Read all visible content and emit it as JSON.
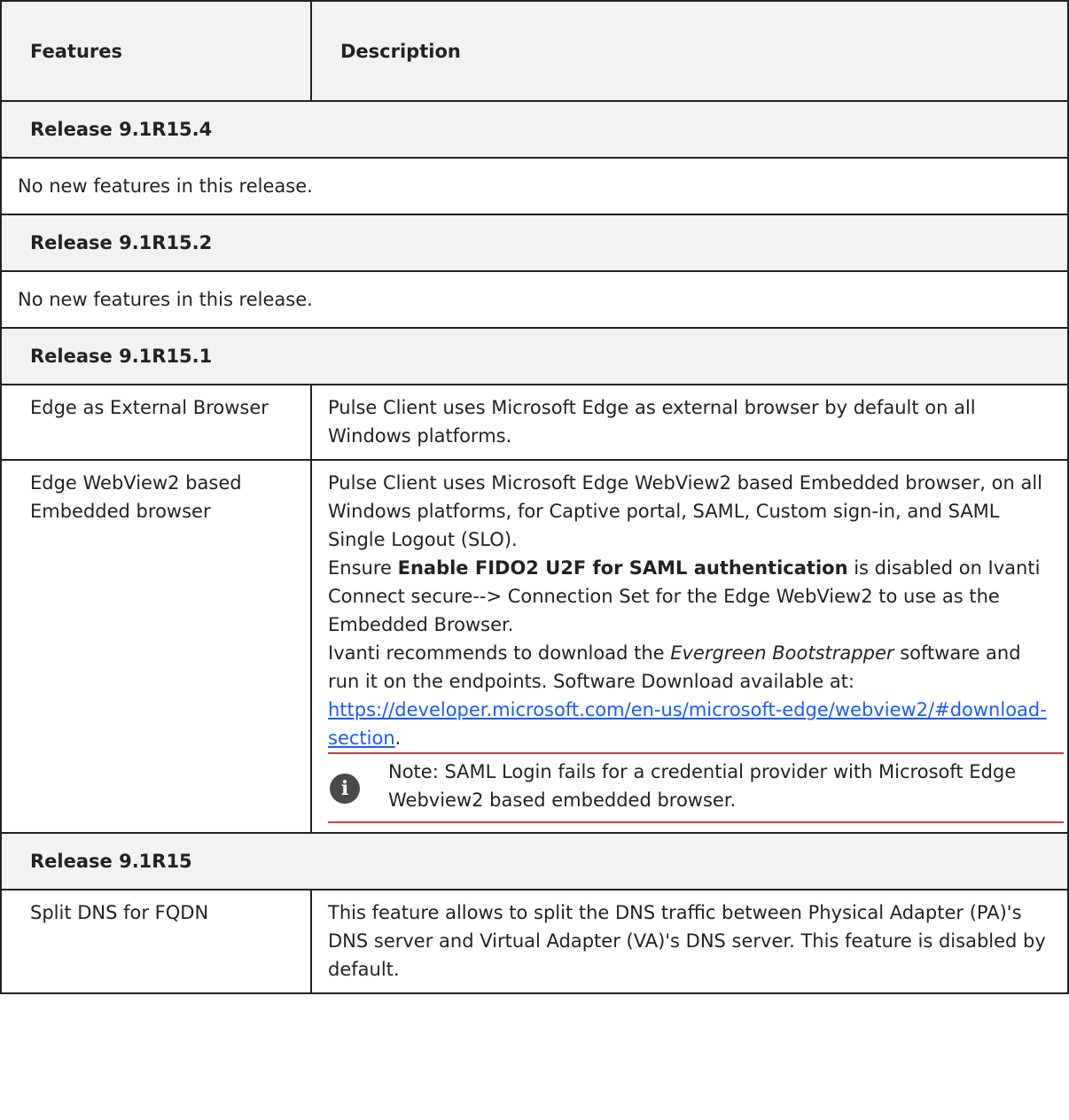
{
  "header": {
    "features": "Features",
    "description": "Description"
  },
  "releases": {
    "r1544": {
      "title": "Release 9.1R15.4",
      "note": "No new features in this release."
    },
    "r1542": {
      "title": "Release 9.1R15.2",
      "note": "No new features in this release."
    },
    "r1541": {
      "title": "Release 9.1R15.1",
      "edge_external": {
        "feature": "Edge as External Browser",
        "description": "Pulse Client uses Microsoft Edge as external browser by default on all Windows platforms."
      },
      "webview2": {
        "feature": "Edge WebView2 based Embedded browser",
        "p1": "Pulse Client uses Microsoft Edge WebView2 based Embedded browser, on all Windows platforms, for Captive portal, SAML, Custom sign-in, and SAML Single Logout (SLO).",
        "p2_pre": "Ensure ",
        "p2_bold": "Enable FIDO2 U2F for SAML authentication",
        "p2_post": " is disabled on Ivanti Connect secure--> Connection Set for the Edge WebView2 to use as the Embedded Browser.",
        "p3_pre": "Ivanti recommends to download the ",
        "p3_italic": "Evergreen Bootstrapper",
        "p3_post": " software and run it on the endpoints. Software Download available at: ",
        "link": "https://developer.microsoft.com/en-us/microsoft-edge/webview2/#download-section",
        "link_tail": ".",
        "note_icon": "info-icon",
        "note": "Note: SAML Login fails for a credential provider with Microsoft Edge Webview2 based embedded browser."
      }
    },
    "r15": {
      "title": "Release 9.1R15",
      "split_dns": {
        "feature": "Split DNS for FQDN",
        "description": "This feature allows to split the DNS traffic between Physical Adapter (PA)'s DNS server and Virtual Adapter (VA)'s DNS server. This feature is disabled by default."
      }
    }
  },
  "colors": {
    "border": "#222222",
    "header_bg": "#f2f2f2",
    "link": "#1a5cff",
    "rule": "#d63a3a",
    "icon_bg": "#4a4a4a"
  }
}
